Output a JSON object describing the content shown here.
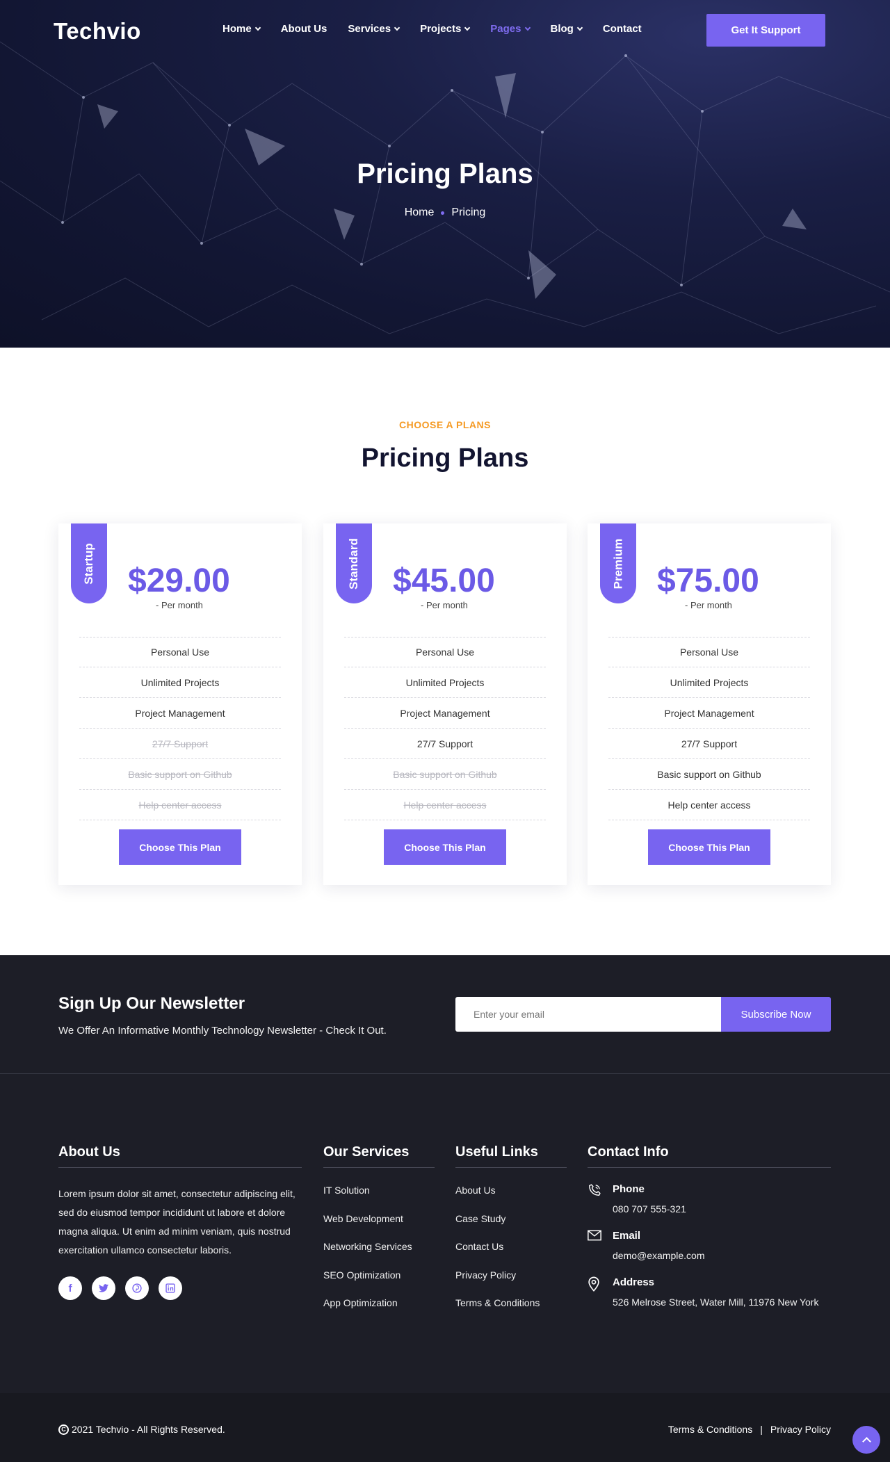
{
  "brand": {
    "logo": "Techvio",
    "accent": "#7864f0",
    "orange": "#f59a23",
    "dark": "#1d1e27"
  },
  "nav": {
    "items": [
      {
        "label": "Home",
        "dropdown": true,
        "active": false
      },
      {
        "label": "About Us",
        "dropdown": false,
        "active": false
      },
      {
        "label": "Services",
        "dropdown": true,
        "active": false
      },
      {
        "label": "Projects",
        "dropdown": true,
        "active": false
      },
      {
        "label": "Pages",
        "dropdown": true,
        "active": true
      },
      {
        "label": "Blog",
        "dropdown": true,
        "active": false
      },
      {
        "label": "Contact",
        "dropdown": false,
        "active": false
      }
    ],
    "cta": "Get It Support"
  },
  "hero": {
    "title": "Pricing Plans",
    "breadcrumb": [
      "Home",
      "Pricing"
    ]
  },
  "pricing": {
    "subtitle": "CHOOSE A PLANS",
    "title": "Pricing Plans",
    "button_label": "Choose This Plan",
    "plans": [
      {
        "name": "Startup",
        "price": "$29.00",
        "period": "- Per month",
        "features": [
          {
            "text": "Personal Use",
            "included": true
          },
          {
            "text": "Unlimited Projects",
            "included": true
          },
          {
            "text": "Project Management",
            "included": true
          },
          {
            "text": "27/7 Support",
            "included": false
          },
          {
            "text": "Basic support on Github",
            "included": false
          },
          {
            "text": "Help center access",
            "included": false
          }
        ]
      },
      {
        "name": "Standard",
        "price": "$45.00",
        "period": "- Per month",
        "features": [
          {
            "text": "Personal Use",
            "included": true
          },
          {
            "text": "Unlimited Projects",
            "included": true
          },
          {
            "text": "Project Management",
            "included": true
          },
          {
            "text": "27/7 Support",
            "included": true
          },
          {
            "text": "Basic support on Github",
            "included": false
          },
          {
            "text": "Help center access",
            "included": false
          }
        ]
      },
      {
        "name": "Premium",
        "price": "$75.00",
        "period": "- Per month",
        "features": [
          {
            "text": "Personal Use",
            "included": true
          },
          {
            "text": "Unlimited Projects",
            "included": true
          },
          {
            "text": "Project Management",
            "included": true
          },
          {
            "text": "27/7 Support",
            "included": true
          },
          {
            "text": "Basic support on Github",
            "included": true
          },
          {
            "text": "Help center access",
            "included": true
          }
        ]
      }
    ]
  },
  "newsletter": {
    "title": "Sign Up Our Newsletter",
    "text": "We Offer An Informative Monthly Technology Newsletter - Check It Out.",
    "placeholder": "Enter your email",
    "button": "Subscribe Now"
  },
  "footer": {
    "about": {
      "title": "About Us",
      "text": "Lorem ipsum dolor sit amet, consectetur adipiscing elit, sed do eiusmod tempor incididunt ut labore et dolore magna aliqua. Ut enim ad minim veniam, quis nostrud exercitation ullamco consectetur laboris.",
      "socials": [
        "facebook-icon",
        "twitter-icon",
        "pinterest-icon",
        "linkedin-icon"
      ]
    },
    "services": {
      "title": "Our Services",
      "links": [
        "IT Solution",
        "Web Development",
        "Networking Services",
        "SEO Optimization",
        "App Optimization"
      ]
    },
    "useful": {
      "title": "Useful Links",
      "links": [
        "About Us",
        "Case Study",
        "Contact Us",
        "Privacy Policy",
        "Terms & Conditions"
      ]
    },
    "contact": {
      "title": "Contact Info",
      "phone_label": "Phone",
      "phone": "080 707 555-321",
      "email_label": "Email",
      "email": "demo@example.com",
      "address_label": "Address",
      "address": "526 Melrose Street, Water Mill, 11976 New York"
    },
    "copyright": "2021 Techvio - All Rights Reserved.",
    "legal": [
      "Terms & Conditions",
      "Privacy Policy"
    ]
  }
}
